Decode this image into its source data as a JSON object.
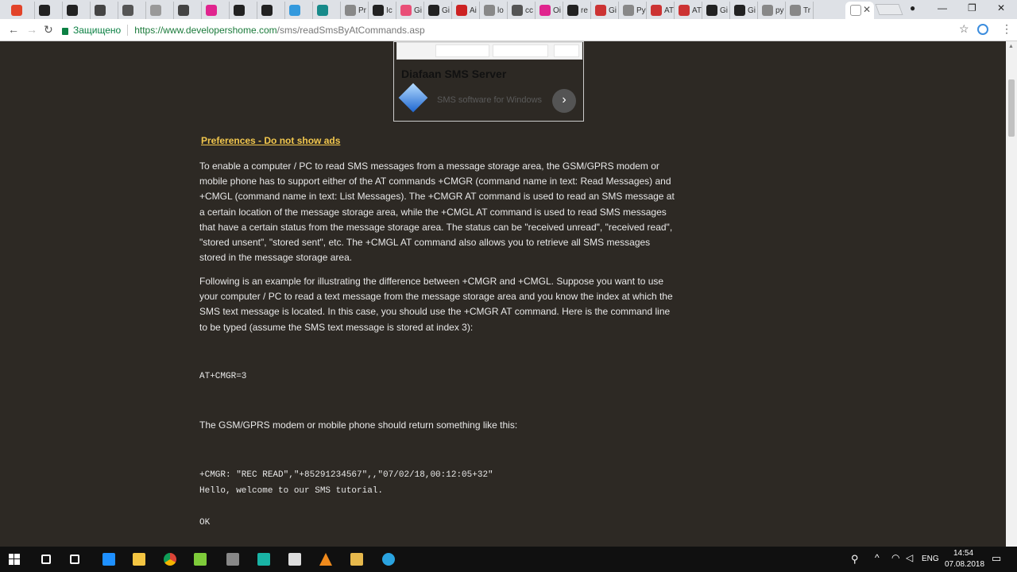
{
  "browser": {
    "tabs": [
      {
        "label": "",
        "color": "#e24329"
      },
      {
        "label": "",
        "color": "#222222"
      },
      {
        "label": "",
        "color": "#222222"
      },
      {
        "label": "",
        "color": "#444444"
      },
      {
        "label": "",
        "color": "#555555"
      },
      {
        "label": "",
        "color": "#999999"
      },
      {
        "label": "",
        "color": "#444444"
      },
      {
        "label": "",
        "color": "#e0248e"
      },
      {
        "label": "",
        "color": "#222222"
      },
      {
        "label": "",
        "color": "#222222"
      },
      {
        "label": "",
        "color": "#3399dd"
      },
      {
        "label": "",
        "color": "#178a8a"
      },
      {
        "label": "Pr",
        "color": "#888888"
      },
      {
        "label": "Ic",
        "color": "#222222"
      },
      {
        "label": "Gi",
        "color": "#e94e77"
      },
      {
        "label": "Gi",
        "color": "#222222"
      },
      {
        "label": "Ai",
        "color": "#cc2222"
      },
      {
        "label": "lo",
        "color": "#888888"
      },
      {
        "label": "cc",
        "color": "#555555"
      },
      {
        "label": "Oi",
        "color": "#e0248e"
      },
      {
        "label": "re",
        "color": "#222222"
      },
      {
        "label": "Gi",
        "color": "#cc3333"
      },
      {
        "label": "Py",
        "color": "#888888"
      },
      {
        "label": "AT",
        "color": "#cc3333"
      },
      {
        "label": "AT",
        "color": "#cc3333"
      },
      {
        "label": "Gi",
        "color": "#222222"
      },
      {
        "label": "Gi",
        "color": "#222222"
      },
      {
        "label": "py",
        "color": "#888888"
      },
      {
        "label": "Tr",
        "color": "#888888"
      }
    ],
    "active_tab": {
      "label": "",
      "close": "✕"
    },
    "window_controls": {
      "user": "●",
      "minimize": "—",
      "restore": "❐",
      "close": "✕"
    },
    "nav": {
      "back": "←",
      "forward": "→",
      "reload": "↻"
    },
    "security_label": "Защищено",
    "url_base": "https://www.developershome.com",
    "url_path": "/sms/readSmsByAtCommands.asp",
    "star": "☆",
    "menu": "⋮"
  },
  "ad": {
    "title": "Diafaan SMS Server",
    "text": "SMS software for Windows",
    "button": "›"
  },
  "preferences_link": "Preferences - Do not show ads",
  "paragraphs": [
    "To enable a computer / PC to read SMS messages from a message storage area, the GSM/GPRS modem or mobile phone has to support either of the AT commands +CMGR (command name in text: Read Messages) and +CMGL (command name in text: List Messages). The +CMGR AT command is used to read an SMS message at a certain location of the message storage area, while the +CMGL AT command is used to read SMS messages that have a certain status from the message storage area. The status can be \"received unread\", \"received read\", \"stored unsent\", \"stored sent\", etc. The +CMGL AT command also allows you to retrieve all SMS messages stored in the message storage area.",
    "Following is an example for illustrating the difference between +CMGR and +CMGL. Suppose you want to use your computer / PC to read a text message from the message storage area and you know the index at which the SMS text message is located. In this case, you should use the +CMGR AT command. Here is the command line to be typed (assume the SMS text message is stored at index 3):",
    "The GSM/GPRS modem or mobile phone should return something like this:"
  ],
  "code": {
    "command": "AT+CMGR=3",
    "response_line1": "+CMGR: \"REC READ\",\"+85291234567\",,\"07/02/18,00:12:05+32\"",
    "response_line2": "Hello, welcome to our SMS tutorial.",
    "ok": "OK"
  },
  "taskbar": {
    "time": "14:54",
    "date": "07.08.2018",
    "language": "ENG",
    "tray_icons": [
      "person-icon",
      "chevron-up-icon",
      "wifi-icon",
      "volume-icon"
    ],
    "apps": [
      {
        "name": "search",
        "color": "#ffffff"
      },
      {
        "name": "task-view",
        "color": "#ffffff"
      },
      {
        "name": "edge",
        "color": "#1e90ff"
      },
      {
        "name": "explorer",
        "color": "#f4c542"
      },
      {
        "name": "chrome",
        "color": "#4caf50"
      },
      {
        "name": "notepad",
        "color": "#7ecb3a"
      },
      {
        "name": "terminal",
        "color": "#888888"
      },
      {
        "name": "webstorm",
        "color": "#19b3a5"
      },
      {
        "name": "document",
        "color": "#dddddd"
      },
      {
        "name": "vlc",
        "color": "#f08a1c"
      },
      {
        "name": "paint",
        "color": "#e6b84c"
      },
      {
        "name": "telegram",
        "color": "#2aa3e0"
      }
    ]
  }
}
